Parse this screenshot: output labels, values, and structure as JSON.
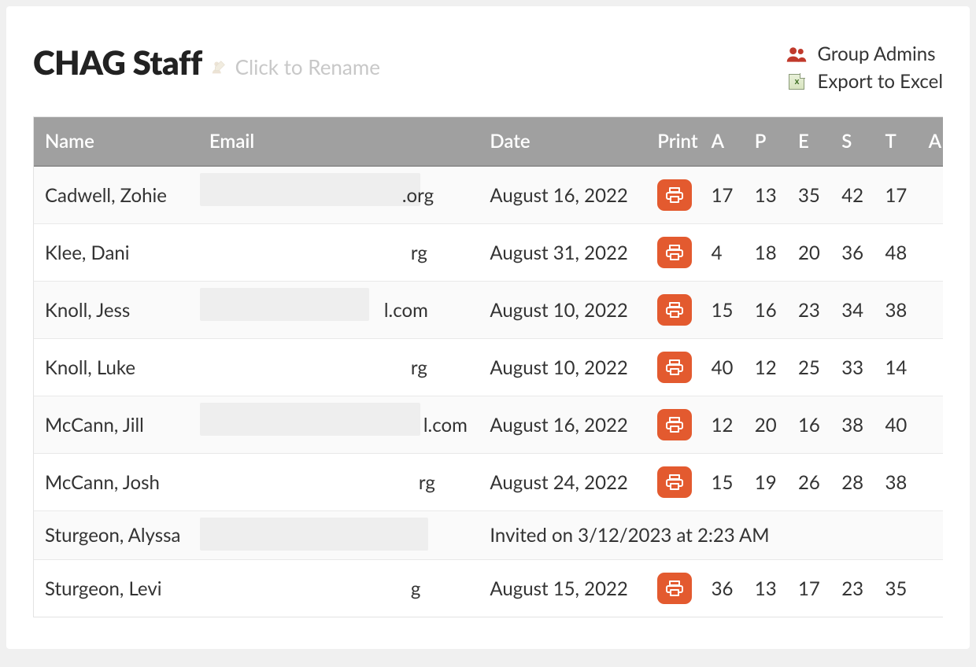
{
  "header": {
    "title": "CHAG Staff",
    "rename_hint": "Click to Rename",
    "actions": {
      "group_admins": "Group Admins",
      "export_excel": "Export to Excel"
    }
  },
  "table": {
    "columns": {
      "name": "Name",
      "email": "Email",
      "date": "Date",
      "print": "Print",
      "a": "A",
      "p": "P",
      "e": "E",
      "s": "S",
      "t": "T",
      "a2": "A"
    },
    "rows": [
      {
        "name": "Cadwell, Zohie",
        "email_suffix": ".org",
        "mask_w": 280,
        "suffix_pad": 245,
        "date": "August 16, 2022",
        "scores": {
          "a": "17",
          "p": "13",
          "e": "35",
          "s": "42",
          "t": "17"
        }
      },
      {
        "name": "Klee, Dani",
        "email_suffix": "rg",
        "mask_w": 0,
        "suffix_pad": 256,
        "date": "August 31, 2022",
        "scores": {
          "a": "4",
          "p": "18",
          "e": "20",
          "s": "36",
          "t": "48"
        }
      },
      {
        "name": "Knoll, Jess",
        "email_suffix": "l.com",
        "mask_w": 215,
        "suffix_pad": 222,
        "date": "August 10, 2022",
        "scores": {
          "a": "15",
          "p": "16",
          "e": "23",
          "s": "34",
          "t": "38"
        }
      },
      {
        "name": "Knoll, Luke",
        "email_suffix": "rg",
        "mask_w": 0,
        "suffix_pad": 256,
        "date": "August 10, 2022",
        "scores": {
          "a": "40",
          "p": "12",
          "e": "25",
          "s": "33",
          "t": "14"
        }
      },
      {
        "name": "McCann, Jill",
        "email_suffix": "l.com",
        "mask_w": 280,
        "suffix_pad": 272,
        "date": "August 16, 2022",
        "scores": {
          "a": "12",
          "p": "20",
          "e": "16",
          "s": "38",
          "t": "40"
        }
      },
      {
        "name": "McCann, Josh",
        "email_suffix": "rg",
        "mask_w": 0,
        "suffix_pad": 266,
        "date": "August 24, 2022",
        "scores": {
          "a": "15",
          "p": "19",
          "e": "26",
          "s": "28",
          "t": "38"
        }
      },
      {
        "name": "Sturgeon, Alyssa",
        "email_suffix": "",
        "mask_w": 290,
        "suffix_pad": 296,
        "invited": "Invited on 3/12/2023 at 2:23 AM"
      },
      {
        "name": "Sturgeon, Levi",
        "email_suffix": "g",
        "mask_w": 0,
        "suffix_pad": 256,
        "date": "August 15, 2022",
        "scores": {
          "a": "36",
          "p": "13",
          "e": "17",
          "s": "23",
          "t": "35"
        }
      }
    ]
  },
  "icons": {
    "print": "printer-icon",
    "group_admins": "people-icon",
    "edit": "edit-person-icon",
    "excel": "excel-icon"
  }
}
